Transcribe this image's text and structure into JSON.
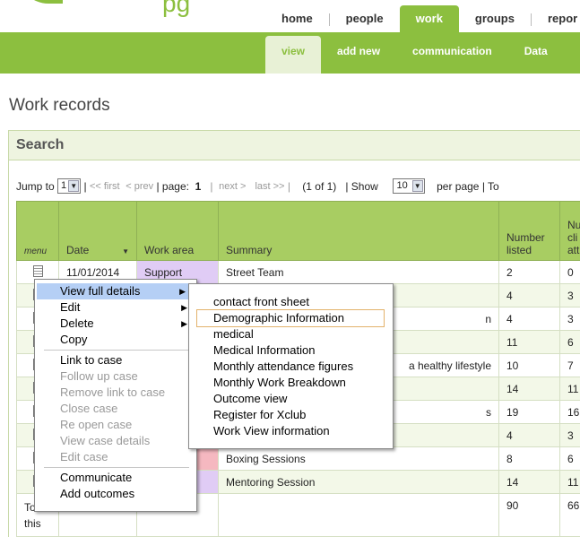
{
  "header": {
    "logo_text": "pg",
    "nav_tabs": [
      {
        "label": "home"
      },
      {
        "label": "people"
      },
      {
        "label": "work"
      },
      {
        "label": "groups"
      },
      {
        "label": "repor"
      }
    ],
    "sub_tabs": [
      {
        "label": "view"
      },
      {
        "label": "add new"
      },
      {
        "label": "communication"
      },
      {
        "label": "Data"
      }
    ]
  },
  "page": {
    "title": "Work records",
    "search_heading": "Search"
  },
  "pager": {
    "jump_to_label": "Jump to",
    "jump_value": "1",
    "first": "<< first",
    "prev": "< prev",
    "page_label": "| page:",
    "page_num": "1",
    "next": "next >",
    "last": "last >>",
    "count": "(1 of 1)",
    "show_label": "| Show",
    "show_value": "10",
    "per_page": "per page | To"
  },
  "table": {
    "headers": {
      "menu": "menu",
      "date": "Date",
      "area": "Work area",
      "summary": "Summary",
      "listed": "Number listed",
      "attended": "Nu cli att"
    },
    "rows": [
      {
        "date": "11/01/2014",
        "area": "Support",
        "summary": "Street Team",
        "listed": "2",
        "attended": "0"
      },
      {
        "date": "",
        "area": "",
        "summary": "",
        "listed": "4",
        "attended": "3"
      },
      {
        "date": "",
        "area": "",
        "summary": "n",
        "listed": "4",
        "attended": "3"
      },
      {
        "date": "",
        "area": "",
        "summary": "",
        "listed": "11",
        "attended": "6"
      },
      {
        "date": "",
        "area": "",
        "summary": "a healthy lifestyle",
        "listed": "10",
        "attended": "7"
      },
      {
        "date": "",
        "area": "",
        "summary": "",
        "listed": "14",
        "attended": "11"
      },
      {
        "date": "",
        "area": "",
        "summary": "s",
        "listed": "19",
        "attended": "16"
      },
      {
        "date": "",
        "area": "",
        "summary": "",
        "listed": "4",
        "attended": "3"
      },
      {
        "date": "",
        "area": "",
        "summary": "Boxing Sessions",
        "listed": "8",
        "attended": "6"
      },
      {
        "date": "",
        "area": "",
        "summary": "Mentoring Session",
        "listed": "14",
        "attended": "11"
      }
    ],
    "total": {
      "label_line1": "To",
      "label_line2": "this",
      "listed": "90",
      "attended": "66"
    }
  },
  "context_menu": {
    "items": [
      {
        "label": "View full details",
        "state": "highlighted",
        "has_submenu": true
      },
      {
        "label": "Edit",
        "state": "normal",
        "has_submenu": true
      },
      {
        "label": "Delete",
        "state": "normal",
        "has_submenu": true
      },
      {
        "label": "Copy",
        "state": "normal"
      },
      {
        "label": "Link to case",
        "state": "normal"
      },
      {
        "label": "Follow up case",
        "state": "disabled"
      },
      {
        "label": "Remove link to case",
        "state": "disabled"
      },
      {
        "label": "Close case",
        "state": "disabled"
      },
      {
        "label": "Re open case",
        "state": "disabled"
      },
      {
        "label": "View case details",
        "state": "disabled"
      },
      {
        "label": "Edit case",
        "state": "disabled"
      },
      {
        "label": "Communicate",
        "state": "normal"
      },
      {
        "label": "Add outcomes",
        "state": "normal"
      }
    ],
    "submenu_arrow": "▶"
  },
  "submenu": {
    "items": [
      {
        "label": "contact front sheet"
      },
      {
        "label": "Demographic Information"
      },
      {
        "label": "medical"
      },
      {
        "label": "Medical Information"
      },
      {
        "label": "Monthly attendance figures"
      },
      {
        "label": "Monthly Work Breakdown"
      },
      {
        "label": "Outcome view"
      },
      {
        "label": "Register for Xclub"
      },
      {
        "label": "Work View information"
      }
    ]
  },
  "colors": {
    "brand_green": "#8cbf3f",
    "header_green": "#a8cd62",
    "menu_highlight": "#b5cff5",
    "focus_outline": "#e3b26b",
    "support_cell": "#e0ccf5",
    "pink_cell": "#f5b8c0"
  }
}
